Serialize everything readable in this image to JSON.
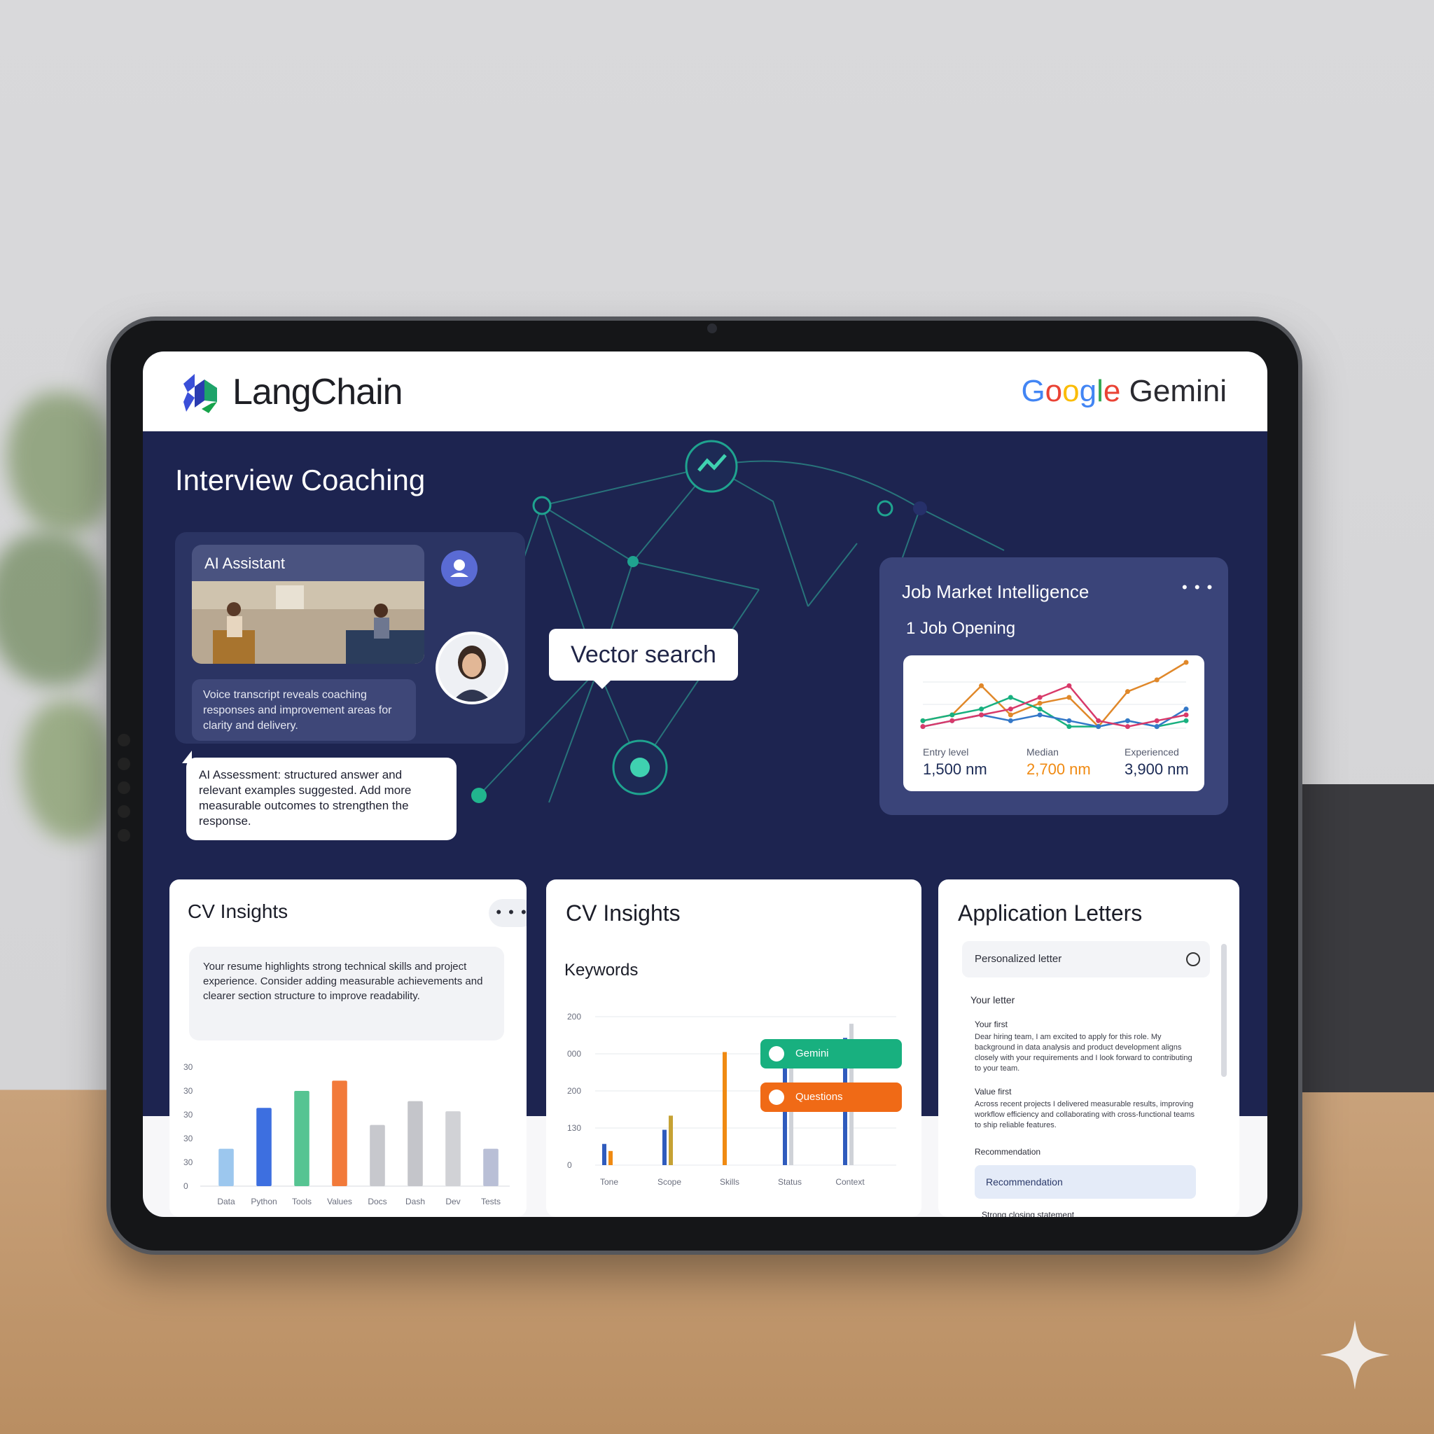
{
  "header": {
    "left_brand": "LangChain",
    "right_brand_google": "Google",
    "right_brand_gemini": "Gemini"
  },
  "coaching": {
    "title": "Interview Coaching",
    "assistant_label": "AI Assistant",
    "transcript": "Voice transcript reveals coaching responses and improvement areas for clarity and delivery.",
    "bubble_text": "AI Assessment: structured answer and relevant examples suggested. Add more measurable outcomes to strengthen the response."
  },
  "vector_label": "Vector search",
  "job_market": {
    "title": "Job Market Intelligence",
    "menu_label": "• • •",
    "subtitle": "1 Job Opening",
    "stats": [
      {
        "label": "Entry level",
        "value": "1,500 nm",
        "color": "#1b2a55"
      },
      {
        "label": "Median",
        "value": "2,700 nm",
        "color": "#f08a12"
      },
      {
        "label": "Experienced",
        "value": "3,900 nm",
        "color": "#1b2a55"
      }
    ]
  },
  "cv_left": {
    "title": "CV Insights",
    "menu_label": "• • •",
    "text": "Your resume highlights strong technical skills and project experience. Consider adding measurable achievements and clearer section structure to improve readability.",
    "y_ticks": [
      "30",
      "30",
      "30",
      "30",
      "30",
      "0"
    ],
    "x_labels": [
      "Data",
      "Python",
      "Tools",
      "Values",
      "Docs",
      "Dash",
      "Dev",
      "Tests"
    ]
  },
  "cv_mid": {
    "title": "CV Insights",
    "subtitle": "Keywords",
    "y_ticks": [
      "200",
      "000",
      "200",
      "130",
      "0"
    ],
    "x_labels": [
      "Tone",
      "Scope",
      "Skills",
      "Status",
      "Context"
    ],
    "pills": [
      {
        "label": "Gemini",
        "color": "#18b07f"
      },
      {
        "label": "Questions",
        "color": "#f06a16"
      }
    ]
  },
  "letters": {
    "title": "Application Letters",
    "search_text": "Personalized letter",
    "heading": "Your letter",
    "sec1_title": "Your first",
    "sec1_body": "Dear hiring team, I am excited to apply for this role. My background in data analysis and product development aligns closely with your requirements and I look forward to contributing to your team.",
    "sec2_title": "Value first",
    "sec2_body": "Across recent projects I delivered measurable results, improving workflow efficiency and collaborating with cross-functional teams to ship reliable features.",
    "sec3_title": "Recommendation",
    "button_label": "Recommendation",
    "footer_line": "Strong closing statement"
  },
  "chart_data": [
    {
      "type": "line",
      "title": "",
      "x": [
        0,
        1,
        2,
        3,
        4,
        5,
        6,
        7,
        8,
        9
      ],
      "series": [
        {
          "name": "",
          "color": "#e0882a",
          "values": [
            2,
            3,
            8,
            3,
            5,
            6,
            1,
            7,
            9,
            12
          ]
        },
        {
          "name": "",
          "color": "#18b07f",
          "values": [
            2,
            3,
            4,
            6,
            4,
            1,
            1,
            2,
            1,
            2
          ]
        },
        {
          "name": "",
          "color": "#3478c8",
          "values": [
            1,
            2,
            3,
            2,
            3,
            2,
            1,
            2,
            1,
            4
          ]
        },
        {
          "name": "",
          "color": "#d83a6a",
          "values": [
            1,
            2,
            3,
            4,
            6,
            8,
            2,
            1,
            2,
            3
          ]
        }
      ],
      "ylim": [
        0,
        12
      ]
    },
    {
      "type": "bar",
      "title": "",
      "categories": [
        "Data",
        "Python",
        "Tools",
        "Values",
        "Docs",
        "Dash",
        "Dev",
        "Tests"
      ],
      "values": [
        11,
        23,
        28,
        31,
        18,
        25,
        22,
        11
      ],
      "colors": [
        "#9cc7ee",
        "#3d6fe0",
        "#56c492",
        "#f27a3a",
        "#c7c8cd",
        "#c4c5ca",
        "#d1d2d6",
        "#b9bfd6"
      ],
      "ylim": [
        0,
        35
      ]
    },
    {
      "type": "bar",
      "title": "",
      "categories": [
        "Tone",
        "Scope",
        "Skills",
        "Status",
        "Context"
      ],
      "series": [
        {
          "name": "",
          "color": "#2f5bbd",
          "values": [
            30,
            50,
            0,
            160,
            180
          ]
        },
        {
          "name": "",
          "color": "#f08a12",
          "values": [
            20,
            0,
            160,
            0,
            0
          ]
        },
        {
          "name": "",
          "color": "#c6a234",
          "values": [
            0,
            70,
            0,
            0,
            0
          ]
        },
        {
          "name": "",
          "color": "#cfd2d8",
          "values": [
            0,
            0,
            0,
            140,
            200
          ]
        }
      ],
      "ylim": [
        0,
        210
      ]
    }
  ]
}
